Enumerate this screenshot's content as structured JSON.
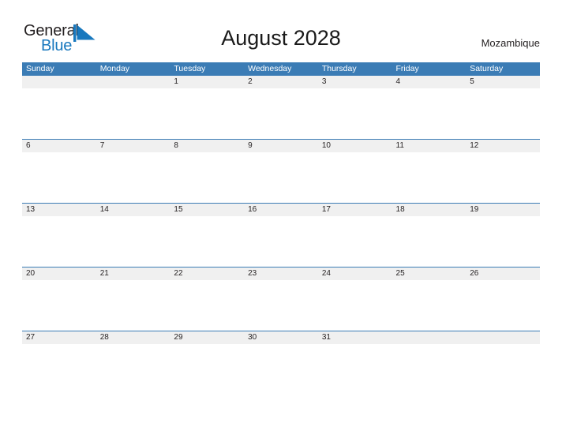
{
  "brand": {
    "name_part1": "General",
    "name_part2": "Blue",
    "mark_icon": "blue-triangle-flag-icon",
    "accent_color": "#1878be"
  },
  "header": {
    "title": "August 2028",
    "location": "Mozambique"
  },
  "colors": {
    "header_blue": "#3b7cb5",
    "date_band_grey": "#f0f0f0",
    "text_dark": "#231f20",
    "page_background": "#ffffff"
  },
  "calendar": {
    "month": "August",
    "year": "2028",
    "weekdays": [
      "Sunday",
      "Monday",
      "Tuesday",
      "Wednesday",
      "Thursday",
      "Friday",
      "Saturday"
    ],
    "weeks": [
      [
        "",
        "",
        "1",
        "2",
        "3",
        "4",
        "5"
      ],
      [
        "6",
        "7",
        "8",
        "9",
        "10",
        "11",
        "12"
      ],
      [
        "13",
        "14",
        "15",
        "16",
        "17",
        "18",
        "19"
      ],
      [
        "20",
        "21",
        "22",
        "23",
        "24",
        "25",
        "26"
      ],
      [
        "27",
        "28",
        "29",
        "30",
        "31",
        "",
        ""
      ]
    ]
  }
}
